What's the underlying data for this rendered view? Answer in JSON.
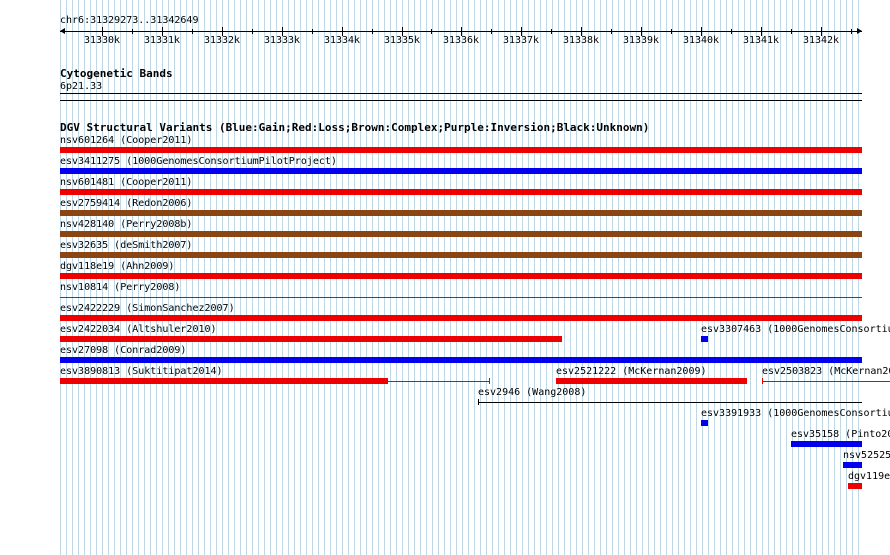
{
  "ruler": {
    "position": "chr6:31329273..31342649",
    "ticks": [
      "31330k",
      "31331k",
      "31332k",
      "31333k",
      "31334k",
      "31335k",
      "31336k",
      "31337k",
      "31338k",
      "31339k",
      "31340k",
      "31341k",
      "31342k"
    ]
  },
  "cytoband": {
    "title": "Cytogenetic Bands",
    "band": "6p21.33"
  },
  "dgv": {
    "title": "DGV Structural Variants (Blue:Gain;Red:Loss;Brown:Complex;Purple:Inversion;Black:Unknown)",
    "colors": {
      "gain": "#0000ee",
      "loss": "#ee0000",
      "complex": "#8b4513",
      "unknown": "#000000"
    },
    "features": [
      {
        "label": "nsv601264 (Cooper2011)",
        "type": "loss"
      },
      {
        "label": "esv3411275 (1000GenomesConsortiumPilotProject)",
        "type": "gain"
      },
      {
        "label": "nsv601481 (Cooper2011)",
        "type": "loss"
      },
      {
        "label": "esv2759414 (Redon2006)",
        "type": "complex"
      },
      {
        "label": "nsv428140 (Perry2008b)",
        "type": "complex"
      },
      {
        "label": "esv32635 (deSmith2007)",
        "type": "complex"
      },
      {
        "label": "dgv118e19 (Ahn2009)",
        "type": "loss"
      },
      {
        "label": "nsv10814 (Perry2008)",
        "type": "loss"
      },
      {
        "label": "esv2422229 (SimonSanchez2007)",
        "type": "loss"
      },
      {
        "label": "esv2422034 (Altshuler2010)",
        "type": "loss"
      },
      {
        "label": "esv3307463 (1000GenomesConsortiu",
        "type": "gain"
      },
      {
        "label": "esv27098 (Conrad2009)",
        "type": "gain"
      },
      {
        "label": "esv3890813 (Suktitipat2014)",
        "type": "loss"
      },
      {
        "label": "esv2521222 (McKernan2009)",
        "type": "loss"
      },
      {
        "label": "esv2503823 (McKernan20",
        "type": "loss"
      },
      {
        "label": "esv2946 (Wang2008)",
        "type": "unknown"
      },
      {
        "label": "esv3391933 (1000GenomesConsortiu",
        "type": "gain"
      },
      {
        "label": "esv35158 (Pinto20",
        "type": "gain"
      },
      {
        "label": "nsv52525",
        "type": "gain"
      },
      {
        "label": "dgv119e",
        "type": "loss"
      }
    ]
  }
}
